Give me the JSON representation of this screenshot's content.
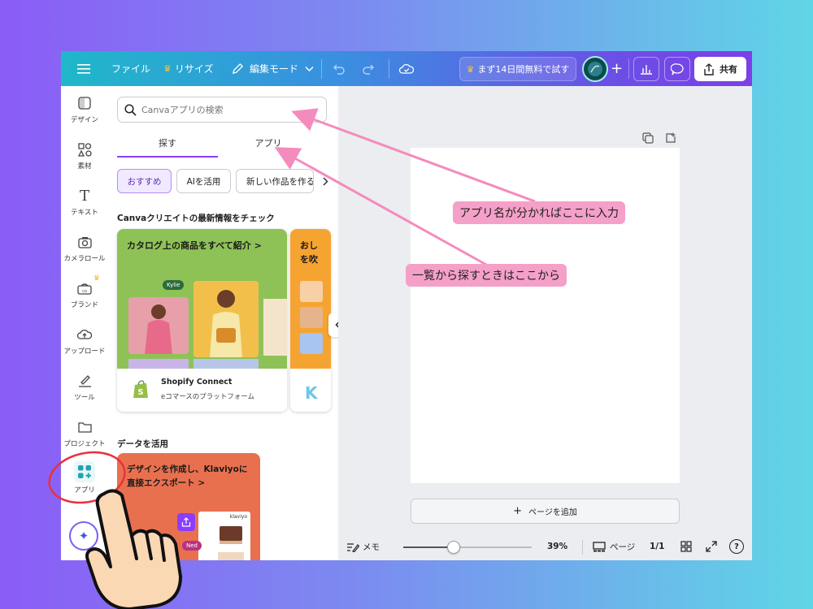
{
  "topbar": {
    "file": "ファイル",
    "resize": "リサイズ",
    "edit_mode": "編集モード",
    "trial": "まず14日間無料で試す",
    "share": "共有"
  },
  "rail": {
    "items": [
      {
        "label": "デザイン",
        "icon": "layout-icon"
      },
      {
        "label": "素材",
        "icon": "elements-icon"
      },
      {
        "label": "テキスト",
        "icon": "text-icon"
      },
      {
        "label": "カメラロール",
        "icon": "camera-icon"
      },
      {
        "label": "ブランド",
        "icon": "brand-icon"
      },
      {
        "label": "アップロード",
        "icon": "upload-icon"
      },
      {
        "label": "ツール",
        "icon": "draw-icon"
      },
      {
        "label": "プロジェクト",
        "icon": "folder-icon"
      },
      {
        "label": "アプリ",
        "icon": "apps-icon"
      }
    ]
  },
  "panel": {
    "search_placeholder": "Canvaアプリの検索",
    "tabs": [
      "探す",
      "アプリ"
    ],
    "chips": [
      "おすすめ",
      "AIを活用",
      "新しい作品を作る"
    ],
    "section1_title": "Canvaクリエイトの最新情報をチェック",
    "card1": {
      "title": "カタログ上の商品をすべて紹介",
      "chevron": ">",
      "name_tag": "Kylie",
      "app_name": "Shopify Connect",
      "app_desc": "eコマースのプラットフォーム"
    },
    "card2": {
      "title": "おし を吹"
    },
    "section2_title": "データを活用",
    "card3": {
      "title": "デザインを作成し、Klaviyoに直接エクスポート",
      "chevron": ">",
      "brand": "klaviyo",
      "name_tag": "Ned"
    }
  },
  "canvas": {
    "add_page": "ページを追加"
  },
  "bottombar": {
    "notes": "メモ",
    "zoom": "39%",
    "zoom_fraction": 0.39,
    "pages": "ページ",
    "page_count": "1/1",
    "help": "?"
  },
  "annotations": {
    "callout1": "アプリ名が分かればここに入力",
    "callout2": "一覧から探すときはここから"
  },
  "colors": {
    "accent": "#8b3dff",
    "callout_bg": "#f5a0c8",
    "arrow": "#f48bbd",
    "circle": "#e8323c"
  }
}
